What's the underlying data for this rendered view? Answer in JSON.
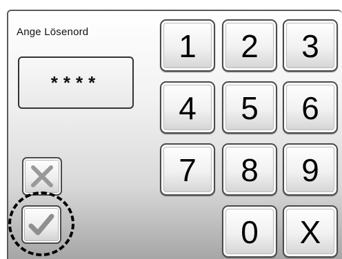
{
  "login": {
    "prompt": "Ange Lösenord",
    "password_mask": "****"
  },
  "keypad": {
    "keys": [
      "1",
      "2",
      "3",
      "4",
      "5",
      "6",
      "7",
      "8",
      "9",
      "0",
      "X"
    ]
  },
  "actions": {
    "cancel_icon": "x-icon",
    "confirm_icon": "checkmark-icon",
    "focused": "confirm"
  }
}
